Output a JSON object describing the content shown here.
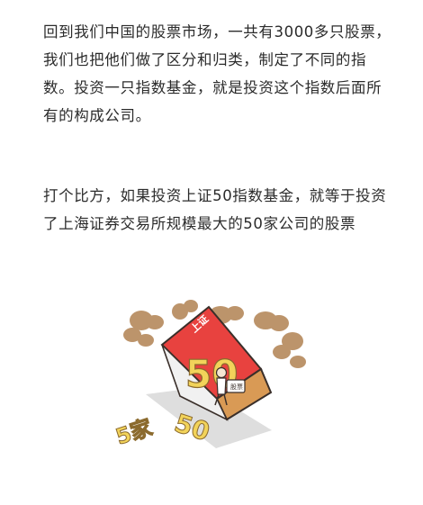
{
  "article": {
    "paragraphs": [
      "回到我们中国的股票市场，一共有3000多只股票，我们也把他们做了区分和归类，制定了不同的指数。投资一只指数基金，就是投资这个指数后面所有的构成公司。",
      "打个比方，如果投资上证50指数基金，就等于投资了上海证券交易所规模最大的50家公司的股票"
    ]
  },
  "illustration": {
    "roof_text": "上证",
    "big_number": "50",
    "sign_text": "股票",
    "floor_number": "50",
    "floor_text": "5家",
    "colors": {
      "roof": "#e8423f",
      "wall": "#d99a55",
      "shadow": "#d8d8d8",
      "number": "#f2d35a",
      "smoke": "#b78b5f",
      "line": "#3a2f2a"
    },
    "icons": [
      "house-icon",
      "person-icon",
      "smoke-cloud-icon"
    ]
  }
}
